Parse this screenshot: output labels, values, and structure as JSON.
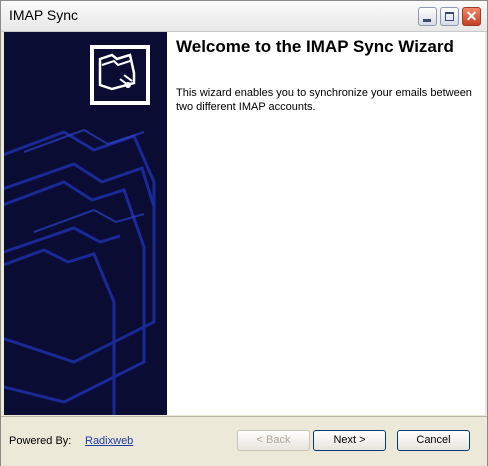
{
  "window": {
    "title": "IMAP Sync"
  },
  "titlebar": {
    "min_icon": "minimize-icon",
    "max_icon": "maximize-icon",
    "close_icon": "close-icon",
    "close_glyph": "✕"
  },
  "wizard": {
    "title": "Welcome to the IMAP Sync Wizard",
    "description": "This wizard enables you to synchronize your emails between two different IMAP accounts.",
    "icon": "folder-network-icon"
  },
  "footer": {
    "powered_by_label": "Powered By:",
    "powered_by_link": "Radixweb",
    "back_label": "< Back",
    "next_label": "Next >",
    "cancel_label": "Cancel"
  },
  "colors": {
    "side_panel": "#0a0c34",
    "accent": "#1f3b9c"
  }
}
